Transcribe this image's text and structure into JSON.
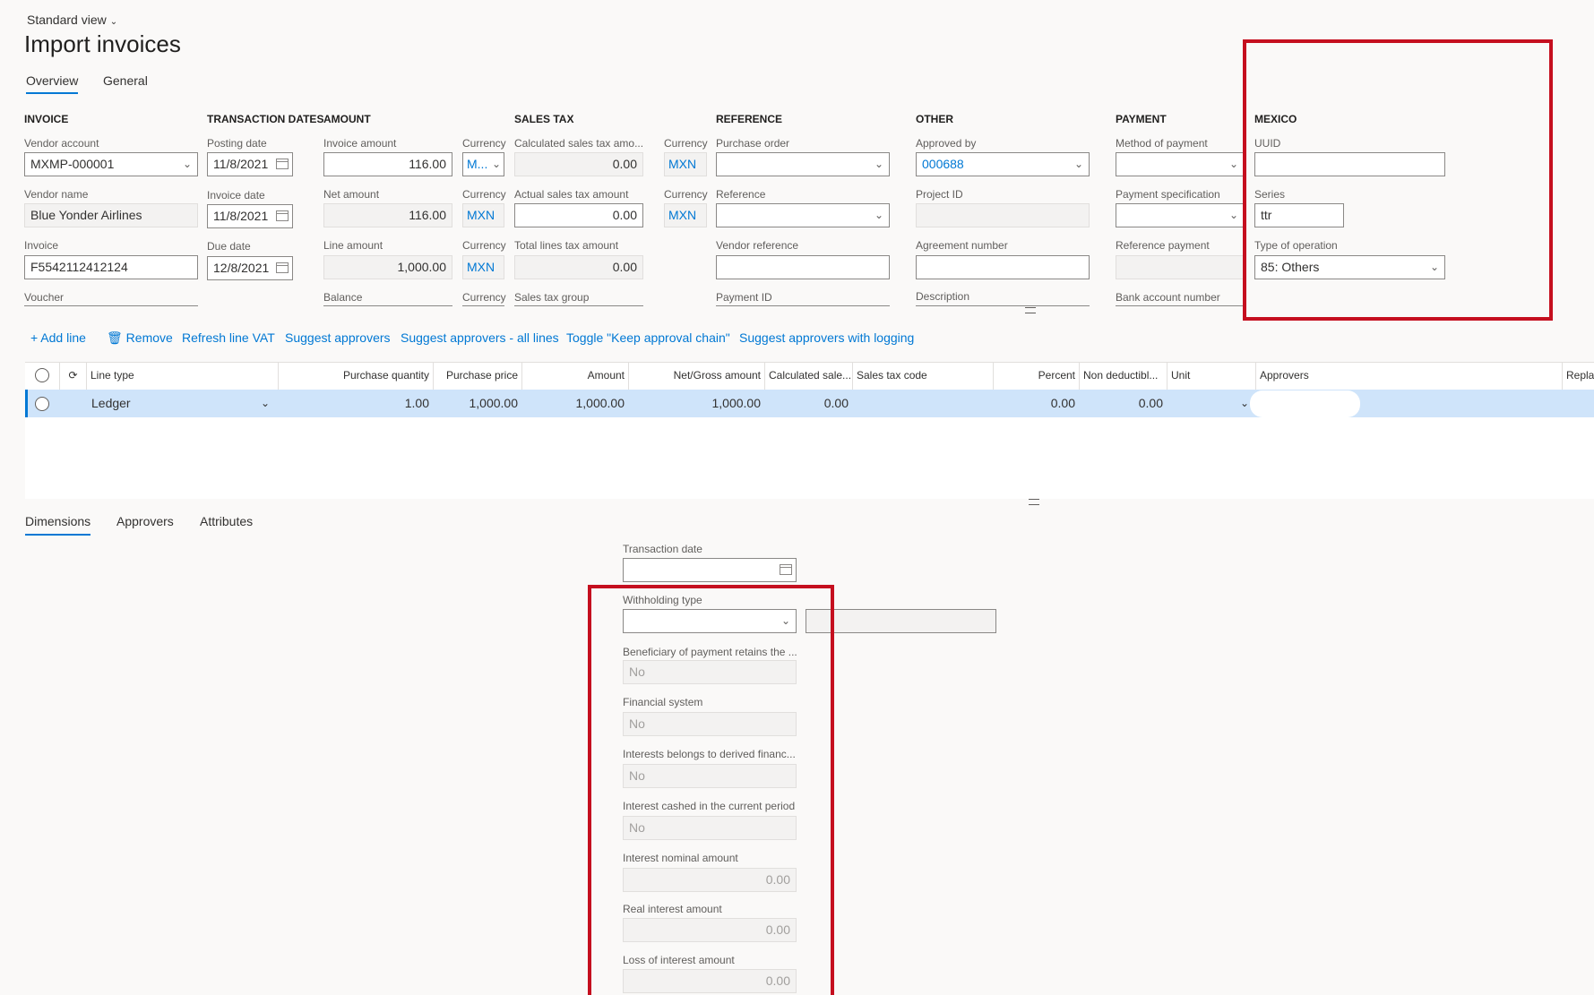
{
  "header": {
    "view_selector": "Standard view",
    "title": "Import invoices",
    "tabs": [
      "Overview",
      "General"
    ]
  },
  "sections": {
    "invoice": "INVOICE",
    "transaction_dates": "TRANSACTION DATES",
    "amount": "AMOUNT",
    "sales_tax": "SALES TAX",
    "reference": "REFERENCE",
    "other": "OTHER",
    "payment": "PAYMENT",
    "mexico": "MEXICO"
  },
  "invoice": {
    "vendor_account_label": "Vendor account",
    "vendor_account": "MXMP-000001",
    "vendor_name_label": "Vendor name",
    "vendor_name": "Blue Yonder Airlines",
    "invoice_label": "Invoice",
    "invoice": "F5542112412124",
    "voucher_label": "Voucher"
  },
  "dates": {
    "posting_label": "Posting date",
    "posting": "11/8/2021",
    "invoice_label": "Invoice date",
    "invoice": "11/8/2021",
    "due_label": "Due date",
    "due": "12/8/2021"
  },
  "amount": {
    "invoice_amount_label": "Invoice amount",
    "invoice_amount": "116.00",
    "net_amount_label": "Net amount",
    "net_amount": "116.00",
    "line_amount_label": "Line amount",
    "line_amount": "1,000.00",
    "balance_label": "Balance",
    "currency_label": "Currency",
    "currency_1": "M...",
    "currency_2": "MXN",
    "currency_3": "MXN"
  },
  "sales_tax": {
    "calculated_label": "Calculated sales tax amo...",
    "calculated": "0.00",
    "actual_label": "Actual sales tax amount",
    "actual": "0.00",
    "total_lines_label": "Total lines tax amount",
    "total_lines": "0.00",
    "group_label": "Sales tax group",
    "currency_label": "Currency",
    "currency_1": "MXN",
    "currency_2": "MXN"
  },
  "reference": {
    "purchase_order_label": "Purchase order",
    "reference_label": "Reference",
    "vendor_reference_label": "Vendor reference",
    "payment_id_label": "Payment ID"
  },
  "other": {
    "approved_by_label": "Approved by",
    "approved_by": "000688",
    "project_id_label": "Project ID",
    "agreement_label": "Agreement number",
    "description_label": "Description"
  },
  "payment": {
    "method_label": "Method of payment",
    "specification_label": "Payment specification",
    "reference_payment_label": "Reference payment",
    "bank_account_label": "Bank account number"
  },
  "mexico": {
    "uuid_label": "UUID",
    "uuid": "",
    "series_label": "Series",
    "series": "ttr",
    "type_label": "Type of operation",
    "type": "85: Others"
  },
  "toolbar": {
    "add_line": "Add line",
    "remove": "Remove",
    "refresh_vat": "Refresh line VAT",
    "suggest": "Suggest approvers",
    "suggest_all": "Suggest approvers - all lines",
    "toggle": "Toggle \"Keep approval chain\"",
    "suggest_logging": "Suggest approvers with logging"
  },
  "grid": {
    "columns": [
      "Line type",
      "Purchase quantity",
      "Purchase price",
      "Amount",
      "Net/Gross amount",
      "Calculated sale...",
      "Sales tax code",
      "Percent",
      "Non deductibl...",
      "Unit",
      "Approvers",
      "Replac"
    ],
    "row": {
      "line_type": "Ledger",
      "purchase_quantity": "1.00",
      "purchase_price": "1,000.00",
      "amount": "1,000.00",
      "net_gross": "1,000.00",
      "calculated": "0.00",
      "sales_tax_code": "",
      "percent": "0.00",
      "non_deductible": "0.00"
    }
  },
  "bottom_tabs": [
    "Dimensions",
    "Approvers",
    "Attributes"
  ],
  "details": {
    "transaction_date_label": "Transaction date",
    "withholding_type_label": "Withholding type",
    "beneficiary_label": "Beneficiary of payment retains the ...",
    "beneficiary": "No",
    "financial_system_label": "Financial system",
    "financial_system": "No",
    "interests_derived_label": "Interests belongs to derived financ...",
    "interests_derived": "No",
    "interest_cashed_label": "Interest cashed in the current period",
    "interest_cashed": "No",
    "interest_nominal_label": "Interest nominal amount",
    "interest_nominal": "0.00",
    "real_interest_label": "Real interest amount",
    "real_interest": "0.00",
    "loss_interest_label": "Loss of interest amount",
    "loss_interest": "0.00"
  },
  "colors": {
    "accent": "#0078d4",
    "highlight_box": "#c50f1f",
    "selected_row": "#cfe4fa"
  }
}
